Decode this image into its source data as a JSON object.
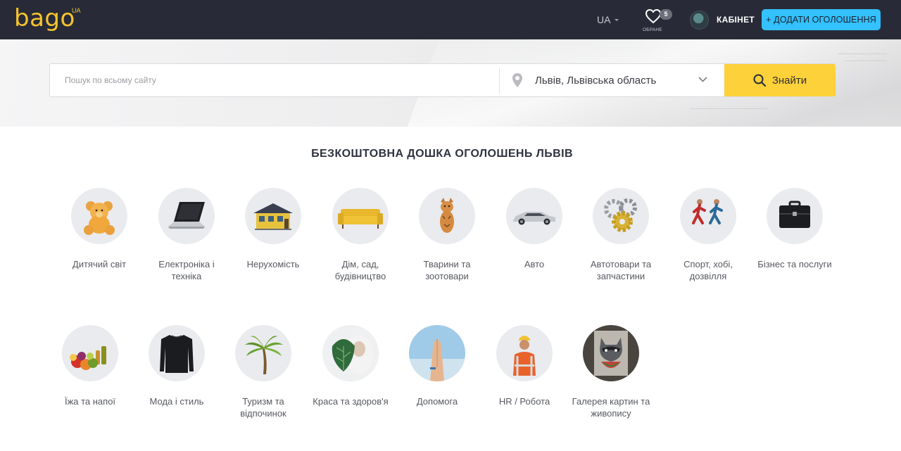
{
  "header": {
    "logo": "bago",
    "logo_sup": "UA",
    "language": "UA",
    "favorites_count": "5",
    "favorites_label": "ОБРАНЕ",
    "cabinet_label": "КАБІНЕТ",
    "add_button_label": "+ ДОДАТИ ОГОЛОШЕННЯ"
  },
  "search": {
    "placeholder": "Пошук по всьому сайту",
    "location": "Львів, Львівська область",
    "button_label": "Знайти"
  },
  "page_title": "БЕЗКОШТОВНА ДОШКА ОГОЛОШЕНЬ ЛЬВІВ",
  "categories": [
    {
      "label": "Дитячий світ",
      "icon": "teddy-bear-icon"
    },
    {
      "label": "Електроніка і техніка",
      "icon": "laptop-icon"
    },
    {
      "label": "Нерухомість",
      "icon": "house-icon"
    },
    {
      "label": "Дім, сад, будівництво",
      "icon": "sofa-icon"
    },
    {
      "label": "Тварини та зоотовари",
      "icon": "cat-icon"
    },
    {
      "label": "Авто",
      "icon": "car-icon"
    },
    {
      "label": "Автотовари та запчастини",
      "icon": "gears-icon"
    },
    {
      "label": "Спорт, хобі, дозвілля",
      "icon": "runners-icon"
    },
    {
      "label": "Бізнес та послуги",
      "icon": "briefcase-icon"
    },
    {
      "label": "Їжа та напої",
      "icon": "food-icon"
    },
    {
      "label": "Мода і стиль",
      "icon": "sweater-icon"
    },
    {
      "label": "Туризм та відпочинок",
      "icon": "palm-tree-icon"
    },
    {
      "label": "Краса та здоров'я",
      "icon": "spa-leaf-icon"
    },
    {
      "label": "Допомога",
      "icon": "helping-hands-icon"
    },
    {
      "label": "HR / Робота",
      "icon": "worker-icon"
    },
    {
      "label": "Галерея картин та живопису",
      "icon": "painting-icon"
    }
  ],
  "colors": {
    "header_bg": "#282b37",
    "logo": "#f6c42e",
    "add_button": "#33c1ff",
    "search_button": "#fdd139"
  }
}
